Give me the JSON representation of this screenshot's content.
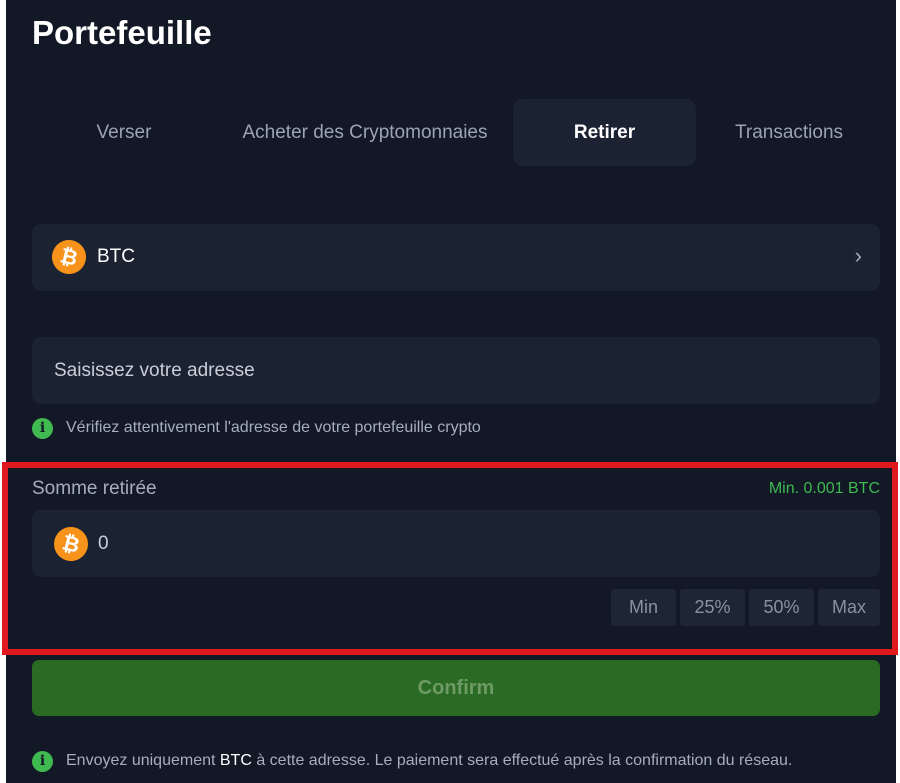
{
  "wallet": {
    "title": "Portefeuille",
    "tabs": [
      {
        "label": "Verser",
        "active": false
      },
      {
        "label": "Acheter des Cryptomonnaies",
        "active": false
      },
      {
        "label": "Retirer",
        "active": true
      },
      {
        "label": "Transactions",
        "active": false
      }
    ]
  },
  "coin_select": {
    "coin": "BTC",
    "coin_icon_glyph": "₿",
    "icon": "bitcoin-icon",
    "chevron": "›",
    "chevron_icon": "chevron-right-icon"
  },
  "address": {
    "placeholder": "Saisissez votre adresse",
    "info_glyph": "i",
    "note": "Vérifiez attentivement l'adresse de votre portefeuille crypto"
  },
  "amount": {
    "label": "Somme retirée",
    "min_hint": "Min. 0.001 BTC",
    "value": "0",
    "coin_icon_glyph": "₿",
    "quick_buttons": [
      "Min",
      "25%",
      "50%",
      "Max"
    ]
  },
  "confirm": {
    "label": "Confirm"
  },
  "footer_note": {
    "info_glyph": "i",
    "before": "Envoyez uniquement ",
    "coin": "BTC",
    "after": " à cette adresse. Le paiement sera effectué après la confirmation du réseau."
  },
  "colors": {
    "background": "#121826",
    "surface": "#1b2232",
    "bitcoin": "#f7931a",
    "accent_green": "#3fb950",
    "confirm_bg": "#2a6a24",
    "highlight": "#e0191e"
  }
}
